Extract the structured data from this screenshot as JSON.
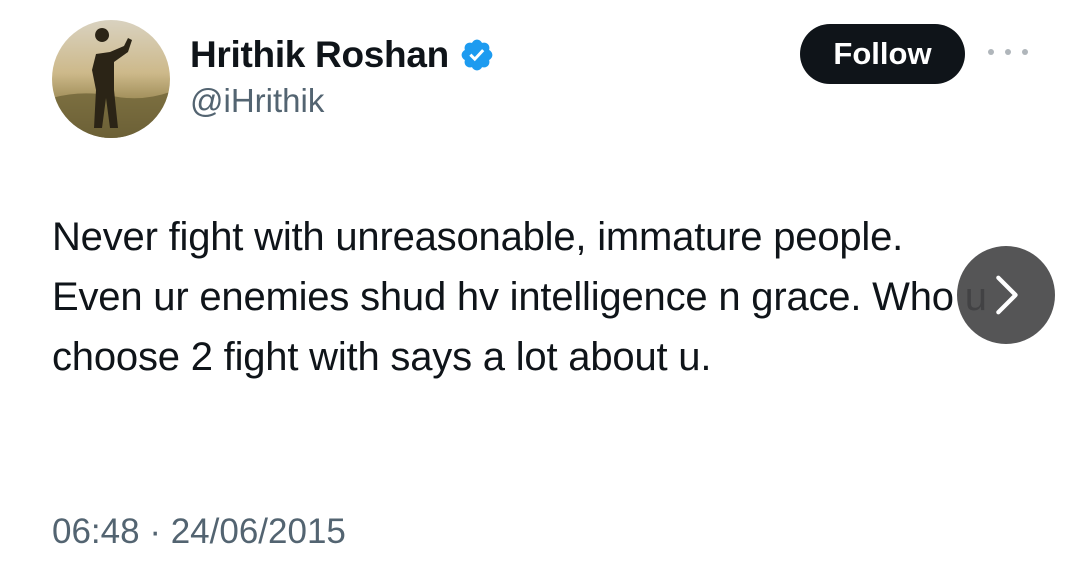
{
  "author": {
    "display_name": "Hrithik Roshan",
    "handle": "@iHrithik",
    "verified": true,
    "avatar_icon": "avatar-silhouette-icon"
  },
  "actions": {
    "follow_label": "Follow",
    "more_icon": "more-options-icon",
    "next_icon": "chevron-right-icon"
  },
  "tweet": {
    "text": "Never fight with unreasonable, immature people. Even ur enemies shud hv intelligence n grace. Who u choose 2 fight with says a lot about u.",
    "time": "06:48",
    "separator": "·",
    "date": "24/06/2015"
  },
  "colors": {
    "text": "#0f1419",
    "secondary": "#536471",
    "verified_blue": "#1d9bf0",
    "follow_bg": "#0f1419",
    "follow_text": "#ffffff"
  }
}
